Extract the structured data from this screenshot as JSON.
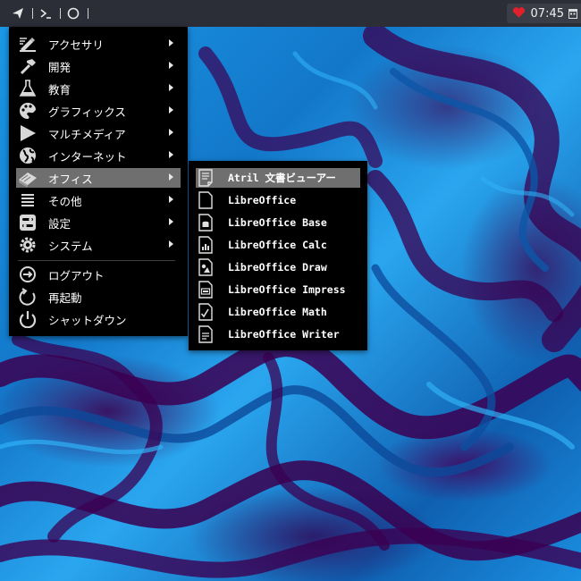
{
  "panel": {
    "clock": "07:45"
  },
  "main_menu": {
    "items": [
      {
        "label": "アクセサリ",
        "icon": "accessories-icon",
        "has_submenu": true
      },
      {
        "label": "開発",
        "icon": "development-hammer-icon",
        "has_submenu": true
      },
      {
        "label": "教育",
        "icon": "education-flask-icon",
        "has_submenu": true
      },
      {
        "label": "グラフィックス",
        "icon": "graphics-palette-icon",
        "has_submenu": true
      },
      {
        "label": "マルチメディア",
        "icon": "multimedia-play-icon",
        "has_submenu": true
      },
      {
        "label": "インターネット",
        "icon": "internet-globe-icon",
        "has_submenu": true
      },
      {
        "label": "オフィス",
        "icon": "office-book-icon",
        "has_submenu": true,
        "active": true
      },
      {
        "label": "その他",
        "icon": "other-list-icon",
        "has_submenu": true
      },
      {
        "label": "設定",
        "icon": "settings-toggle-icon",
        "has_submenu": true
      },
      {
        "label": "システム",
        "icon": "system-gear-icon",
        "has_submenu": true
      },
      {
        "label": "ログアウト",
        "icon": "logout-icon",
        "has_submenu": false
      },
      {
        "label": "再起動",
        "icon": "reboot-icon",
        "has_submenu": false
      },
      {
        "label": "シャットダウン",
        "icon": "shutdown-icon",
        "has_submenu": false
      }
    ]
  },
  "office_submenu": {
    "items": [
      {
        "label": "Atril 文書ビューアー",
        "icon": "atril-document-viewer-icon",
        "active": true
      },
      {
        "label": "LibreOffice",
        "icon": "libreoffice-doc-icon"
      },
      {
        "label": "LibreOffice Base",
        "icon": "libreoffice-base-icon"
      },
      {
        "label": "LibreOffice Calc",
        "icon": "libreoffice-calc-icon"
      },
      {
        "label": "LibreOffice Draw",
        "icon": "libreoffice-draw-icon"
      },
      {
        "label": "LibreOffice Impress",
        "icon": "libreoffice-impress-icon"
      },
      {
        "label": "LibreOffice Math",
        "icon": "libreoffice-math-icon"
      },
      {
        "label": "LibreOffice Writer",
        "icon": "libreoffice-writer-icon"
      }
    ]
  },
  "colors": {
    "panel_bg": "#2b2e36",
    "menu_bg": "#000000",
    "highlight": "#6f6f6f",
    "wallpaper_blue": "#1a8fe0",
    "wallpaper_purple": "#3c0050",
    "heart": "#e0202a"
  }
}
